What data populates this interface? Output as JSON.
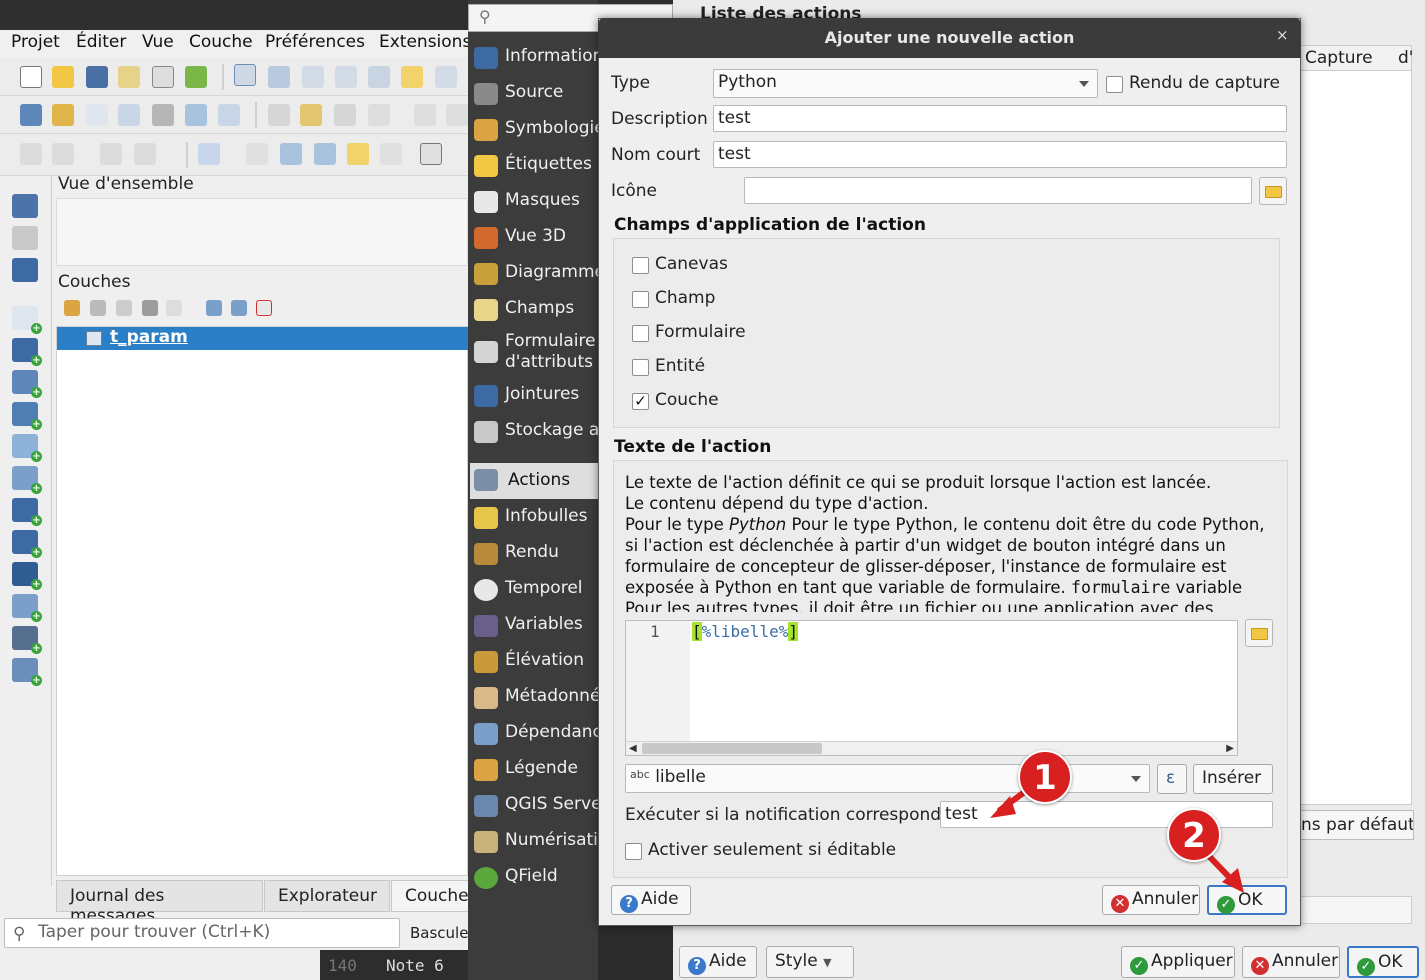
{
  "menubar": [
    "Projet",
    "Éditer",
    "Vue",
    "Couche",
    "Préférences",
    "Extensions"
  ],
  "panels": {
    "overview_title": "Vue d'ensemble",
    "layers_title": "Couches",
    "layer_name": "t_param"
  },
  "bottom_tabs": [
    "Journal des messages",
    "Explorateur",
    "Couches"
  ],
  "search": {
    "placeholder": "Taper pour trouver (Ctrl+K)",
    "bascule": "Bascule"
  },
  "editor_strip": {
    "line": "140",
    "text": "Note 6"
  },
  "properties_menu": [
    "Information",
    "Source",
    "Symbologie",
    "Étiquettes",
    "Masques",
    "Vue 3D",
    "Diagramme",
    "Champs",
    "Formulaire d'attributs",
    "Jointures",
    "Stockage au",
    "Actions",
    "Infobulles",
    "Rendu",
    "Temporel",
    "Variables",
    "Élévation",
    "Métadonné",
    "Dépendanc",
    "Légende",
    "QGIS Serve",
    "Numérisatio",
    "QField"
  ],
  "properties_selected": "Actions",
  "background": {
    "list_title": "Liste des actions",
    "capture_header": "Capture",
    "extra_header": "d'",
    "default_button": "ns par défaut",
    "buttons": [
      "Aide",
      "Style",
      "Appliquer",
      "Annuler",
      "OK"
    ]
  },
  "dialog": {
    "title": "Ajouter une nouvelle action",
    "close": "×",
    "type_label": "Type",
    "type_value": "Python",
    "capture_label": "Rendu de capture",
    "capture_checked": false,
    "description_label": "Description",
    "description_value": "test",
    "shortname_label": "Nom court",
    "shortname_value": "test",
    "icon_label": "Icône",
    "icon_value": "",
    "scopes_title": "Champs d'application de l'action",
    "scopes": [
      {
        "label": "Canevas",
        "checked": false
      },
      {
        "label": "Champ",
        "checked": false
      },
      {
        "label": "Formulaire",
        "checked": false
      },
      {
        "label": "Entité",
        "checked": false
      },
      {
        "label": "Couche",
        "checked": true
      }
    ],
    "action_text_title": "Texte de l'action",
    "help": {
      "line1": "Le texte de l'action définit ce qui se produit lorsque l'action est lancée.",
      "line2": "Le contenu dépend du type d'action.",
      "line3_pre": "Pour le type ",
      "line3_em": "Python",
      "line3_post": " Pour le type Python, le contenu doit être du code Python, si l'action est déclenchée à partir d'un widget de bouton intégré dans un formulaire de concepteur de glisser-déposer, l'instance de formulaire est exposée à Python en tant que variable de formulaire. ",
      "line3_code": "formulaire",
      "line3_end": " variable",
      "line4": "Pour les autres types, il doit être un fichier ou une application avec des"
    },
    "code_line_number": "1",
    "code_open": "[",
    "code_body": "%libelle%",
    "code_close": "]",
    "field_prefix": "abc",
    "field_value": "libelle",
    "expression_symbol": "ε",
    "insert_label": "Insérer",
    "notify_label": "Exécuter si la notification correspond.",
    "notify_value": "test",
    "editable_label": "Activer seulement si éditable",
    "editable_checked": false,
    "help_button": "Aide",
    "cancel_button": "Annuler",
    "ok_button": "OK"
  },
  "annotations": [
    "1",
    "2"
  ],
  "colors": {
    "accent_red": "#d92020",
    "selection_blue": "#2a7fc7",
    "code_bracket": "#a6e22e"
  }
}
